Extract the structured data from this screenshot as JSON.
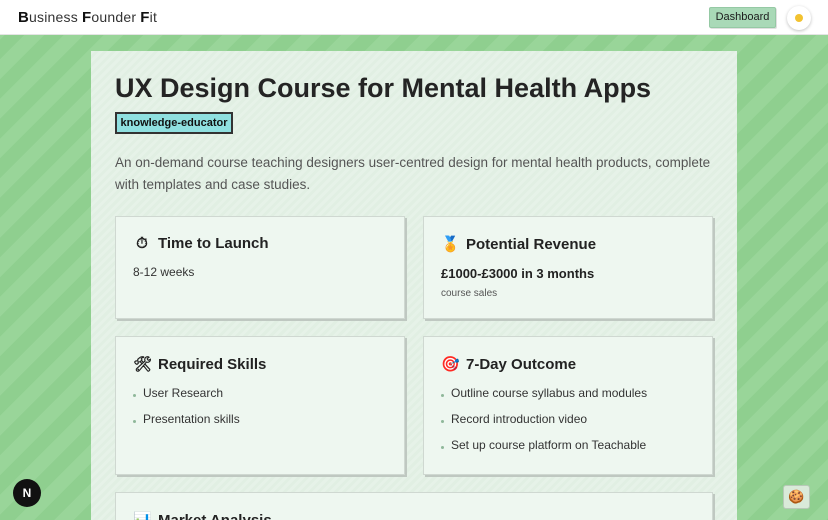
{
  "header": {
    "brand": [
      {
        "initial": "B",
        "rest": "usiness "
      },
      {
        "initial": "F",
        "rest": "ounder "
      },
      {
        "initial": "F",
        "rest": "it"
      }
    ],
    "dashboard_label": "Dashboard",
    "theme_icon": "sun-icon"
  },
  "idea": {
    "title": "UX Design Course for Mental Health Apps",
    "tag": "knowledge-educator",
    "description": "An on-demand course teaching designers user-centred design for mental health products, complete with templates and case studies."
  },
  "cards": {
    "launch": {
      "icon": "⏱",
      "icon_name": "stopwatch-icon",
      "title": "Time to Launch",
      "value": "8-12 weeks"
    },
    "revenue": {
      "icon": "🏅",
      "icon_name": "medal-icon",
      "title": "Potential Revenue",
      "value": "£1000-£3000 in 3 months",
      "note": "course sales"
    },
    "skills": {
      "icon": "🛠",
      "icon_name": "tools-icon",
      "title": "Required Skills",
      "items": [
        "User Research",
        "Presentation skills"
      ]
    },
    "outcome": {
      "icon": "🎯",
      "icon_name": "target-icon",
      "title": "7-Day Outcome",
      "items": [
        "Outline course syllabus and modules",
        "Record introduction video",
        "Set up course platform on Teachable"
      ]
    },
    "market": {
      "icon": "📊",
      "icon_name": "chart-icon",
      "title": "Market Analysis"
    }
  },
  "floating": {
    "next_badge": "N",
    "cookie_icon": "🍪"
  },
  "colors": {
    "accent_green": "#a9d9b7",
    "tag_bg": "#8fe0e0",
    "background": "#8fcf8f"
  }
}
